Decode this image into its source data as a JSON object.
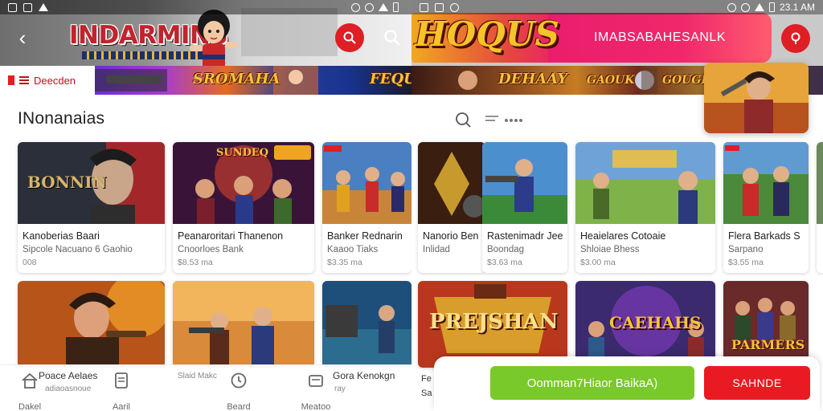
{
  "left": {
    "status": {
      "time": ""
    },
    "logo_text": "INDARMINS",
    "banner": {
      "label": "Deecden",
      "title_a": "SROMAHA",
      "title_b": "FEQUA"
    },
    "section_title": "INonanaias",
    "row1": [
      {
        "title": "Kanoberias Baari",
        "subtitle": "Sipcole Nacuano  6 Gaohio",
        "meta": "008"
      },
      {
        "title": "Peanaroritari Thanenon",
        "subtitle": "Cnoorloes Bank",
        "meta": "$8.53 ma"
      },
      {
        "title": "Banker Rednarin",
        "subtitle": "Kaaoo Tiaks",
        "meta": "$3.35 ma"
      }
    ],
    "thumb_texts": {
      "c1": "BONNIN",
      "c2": "SUNDEQ"
    },
    "row2_captions": {
      "c1": "Poace Aelaes",
      "c1_sub": "adiaoasnoue",
      "c2": "Slaid Makc",
      "c3": "Gora Kenokgn",
      "c3_sub": "ray"
    },
    "tabs": [
      {
        "label": "Dakel"
      },
      {
        "label": "Aaril"
      },
      {
        "label": "Beard"
      },
      {
        "label": "Meatoo"
      }
    ]
  },
  "right": {
    "status": {
      "time": "23.1 AM"
    },
    "hero_title": "HOQUS",
    "hero_banner": "IMABSABAHESANLK",
    "banner": {
      "title_a": "DEHAAY",
      "title_b": "GAOUK",
      "title_c": "GOUGB"
    },
    "row1": [
      {
        "title": "Nanorio Ben",
        "subtitle": "Inlidad",
        "meta": ""
      },
      {
        "title": "Rastenimadr Jee",
        "subtitle": "Boondag",
        "meta": "$3.63 ma"
      },
      {
        "title": "Heaielares Cotoaie",
        "subtitle": "Shloiae Bhess",
        "meta": "$3.00 ma"
      },
      {
        "title": "Flera Barkads   S",
        "subtitle": "Sarpano",
        "meta": "$3.55 ma"
      }
    ],
    "thumb_texts": {
      "c1": "PREJSHAN",
      "c2": "CAEHAHS",
      "c3": "PARMERS"
    },
    "peek_captions": {
      "a": "Fe",
      "b": "Sa"
    },
    "actions": {
      "primary": "Oomman7Hiaor BaikaA)",
      "secondary": "SAHNDE"
    }
  },
  "colors": {
    "accent_red": "#e01e25",
    "accent_green": "#7ac92a",
    "hero_pink": "#ea1d6c"
  }
}
